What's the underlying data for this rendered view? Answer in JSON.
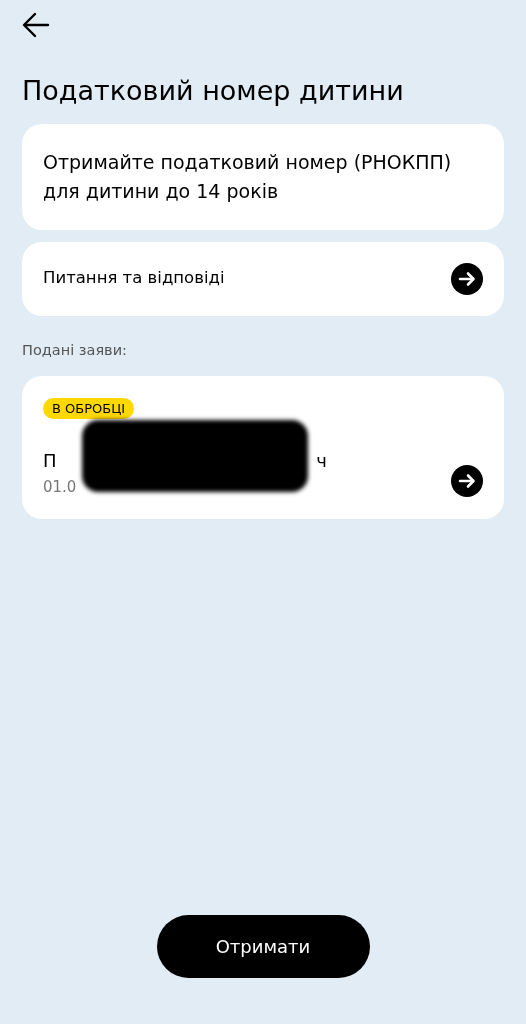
{
  "header": {
    "title": "Податковий номер дитини"
  },
  "intro": {
    "text": "Отримайте податковий номер (РНОКПП) для дитини до 14 років"
  },
  "faq": {
    "label": "Питання та відповіді"
  },
  "applications": {
    "heading": "Подані заяви:",
    "items": [
      {
        "status": "В ОБРОБЦІ",
        "color": "#ffd800",
        "name_start": "П",
        "name_end": "ч",
        "date": "01.0"
      }
    ]
  },
  "primary_button": {
    "label": "Отримати"
  }
}
